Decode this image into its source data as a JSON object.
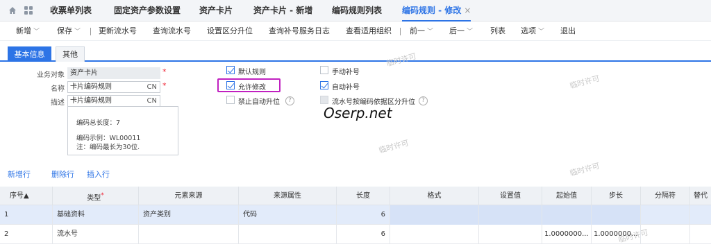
{
  "tabs": [
    {
      "label": "收票单列表"
    },
    {
      "label": "固定资产参数设置"
    },
    {
      "label": "资产卡片"
    },
    {
      "label": "资产卡片 - 新增"
    },
    {
      "label": "编码规则列表"
    },
    {
      "label": "编码规则 - 修改",
      "close": "×"
    }
  ],
  "toolbar": {
    "new": "新增",
    "save": "保存",
    "update_serial": "更新流水号",
    "query_serial": "查询流水号",
    "set_segment_upgrade": "设置区分升位",
    "query_fill_log": "查询补号服务日志",
    "view_orgs": "查看适用组织",
    "prev": "前一",
    "next": "后一",
    "list": "列表",
    "options": "选项",
    "exit": "退出"
  },
  "subtabs": {
    "basic": "基本信息",
    "other": "其他"
  },
  "form": {
    "business_object_label": "业务对象",
    "business_object_value": "资产卡片",
    "name_label": "名称",
    "name_value": "卡片编码规则",
    "desc_label": "描述",
    "desc_value": "卡片编码规则",
    "lang": "CN",
    "required_mark": "*",
    "default_rule": "默认规则",
    "allow_modify": "允许修改",
    "disable_auto_upgrade": "禁止自动升位",
    "manual_fill": "手动补号",
    "auto_fill": "自动补号",
    "serial_by_segment": "流水号按编码依据区分升位",
    "help": "?"
  },
  "info": {
    "total_length": "编码总长度：7",
    "example": "编码示例：WL00011",
    "note": "注：编码最长为30位."
  },
  "logo": "Oserp.net",
  "watermark": "临时许可",
  "row_actions": {
    "add": "新增行",
    "delete": "删除行",
    "insert": "插入行"
  },
  "table": {
    "headers": [
      "序号▲",
      "类型",
      "元素来源",
      "来源属性",
      "长度",
      "格式",
      "设置值",
      "起始值",
      "步长",
      "分隔符",
      "替代"
    ],
    "rows": [
      [
        "1",
        "基础资料",
        "资产类别",
        "代码",
        "6",
        "",
        "",
        "",
        "",
        "",
        ""
      ],
      [
        "2",
        "流水号",
        "",
        "",
        "6",
        "",
        "",
        "1.0000000...",
        "1.0000000...",
        "",
        ""
      ]
    ]
  },
  "colors": {
    "accent": "#2d74e6",
    "highlight_box": "#c020c0"
  }
}
